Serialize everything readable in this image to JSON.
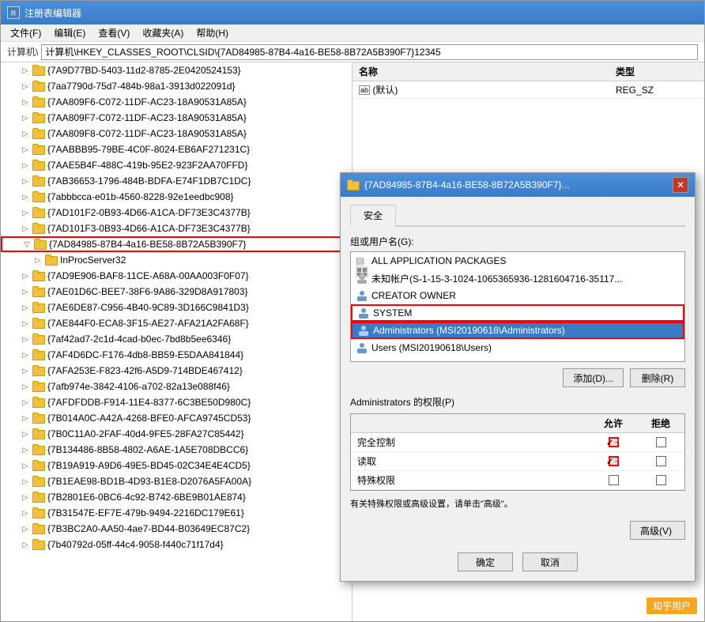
{
  "window": {
    "title": "注册表编辑器",
    "address": "计算机\\HKEY_CLASSES_ROOT\\CLSID\\{7AD84985-87B4-4a16-BE58-8B72A5B390F7}12345"
  },
  "menu": {
    "items": [
      "文件(F)",
      "编辑(E)",
      "查看(V)",
      "收藏夹(A)",
      "帮助(H)"
    ]
  },
  "tree": {
    "items": [
      {
        "label": "{7A9D77BD-5403-11d2-8785-2E0420524153}",
        "indent": 1,
        "expanded": false
      },
      {
        "label": "{7aa7790d-75d7-484b-98a1-3913d022091d}",
        "indent": 1,
        "expanded": false
      },
      {
        "label": "{7AA809F6-C072-11DF-AC23-18A90531A85A}",
        "indent": 1,
        "expanded": false
      },
      {
        "label": "{7AA809F7-C072-11DF-AC23-18A90531A85A}",
        "indent": 1,
        "expanded": false
      },
      {
        "label": "{7AA809F8-C072-11DF-AC23-18A90531A85A}",
        "indent": 1,
        "expanded": false
      },
      {
        "label": "{7AABBB95-79BE-4C0F-8024-EB6AF271231C}",
        "indent": 1,
        "expanded": false
      },
      {
        "label": "{7AAE5B4F-488C-419b-95E2-923F2AA70FFD}",
        "indent": 1,
        "expanded": false
      },
      {
        "label": "{7AB36653-1796-484B-BDFA-E74F1DB7C1DC}",
        "indent": 1,
        "expanded": false
      },
      {
        "label": "{7abbbcca-e01b-4560-8228-92e1eedbc908}",
        "indent": 1,
        "expanded": false
      },
      {
        "label": "{7AD101F2-0B93-4D66-A1CA-DF73E3C4377B}",
        "indent": 1,
        "expanded": false
      },
      {
        "label": "{7AD101F3-0B93-4D66-A1CA-DF73E3C4377B}",
        "indent": 1,
        "expanded": false
      },
      {
        "label": "{7AD84985-87B4-4a16-BE58-8B72A5B390F7}",
        "indent": 1,
        "expanded": true,
        "selected": false,
        "highlighted": true
      },
      {
        "label": "InProcServer32",
        "indent": 2,
        "expanded": false
      },
      {
        "label": "{7AD9E906-BAF8-11CE-A68A-00AA003F0F07}",
        "indent": 1,
        "expanded": false
      },
      {
        "label": "{7AE01D6C-BEE7-38F6-9A86-329D8A917803}",
        "indent": 1,
        "expanded": false
      },
      {
        "label": "{7AE6DE87-C956-4B40-9C89-3D166C9841D3}",
        "indent": 1,
        "expanded": false
      },
      {
        "label": "{7AE844F0-ECA8-3F15-AE27-AFA21A2FA68F}",
        "indent": 1,
        "expanded": false
      },
      {
        "label": "{7af42ad7-2c1d-4cad-b0ec-7bd8b5ee6346}",
        "indent": 1,
        "expanded": false
      },
      {
        "label": "{7AF4D6DC-F176-4db8-BB59-E5DAA841844}",
        "indent": 1,
        "expanded": false
      },
      {
        "label": "{7AFA253E-F823-42f6-A5D9-714BDE467412}",
        "indent": 1,
        "expanded": false
      },
      {
        "label": "{7afb974e-3842-4106-a702-82a13e088f46}",
        "indent": 1,
        "expanded": false
      },
      {
        "label": "{7AFDFDDB-F914-11E4-8377-6C3BE50D980C}",
        "indent": 1,
        "expanded": false
      },
      {
        "label": "{7B014A0C-A42A-4268-BFE0-AFCA9745CD53}",
        "indent": 1,
        "expanded": false
      },
      {
        "label": "{7B0C11A0-2FAF-40d4-9FE5-28FA27C85442}",
        "indent": 1,
        "expanded": false
      },
      {
        "label": "{7B134486-8B58-4802-A6AE-1A5E708DBCC6}",
        "indent": 1,
        "expanded": false
      },
      {
        "label": "{7B19A919-A9D6-49E5-BD45-02C34E4E4CD5}",
        "indent": 1,
        "expanded": false
      },
      {
        "label": "{7B1EAE98-BD1B-4D93-B1E8-D2076A5FA00A}",
        "indent": 1,
        "expanded": false
      },
      {
        "label": "{7B2801E6-0BC6-4c92-B742-6BE9B01AE874}",
        "indent": 1,
        "expanded": false
      },
      {
        "label": "{7B31547E-EF7E-479b-9494-2216DC179E61}",
        "indent": 1,
        "expanded": false
      },
      {
        "label": "{7B3BC2A0-AA50-4ae7-BD44-B03649EC87C2}",
        "indent": 1,
        "expanded": false
      },
      {
        "label": "{7b40792d-05ff-44c4-9058-f440c71f17d4}",
        "indent": 1,
        "expanded": false
      }
    ]
  },
  "right_panel": {
    "columns": [
      "名称",
      "类型"
    ],
    "rows": [
      {
        "name": "(默认)",
        "type": "REG_SZ",
        "icon": "ab"
      }
    ]
  },
  "security_dialog": {
    "title": "{7AD84985-87B4-4a16-BE58-8B72A5B390F7}...",
    "tab": "安全",
    "group_label": "组或用户名(G):",
    "groups": [
      {
        "name": "ALL APPLICATION PACKAGES",
        "icon": "packages"
      },
      {
        "name": "未知帐户(S-1-15-3-1024-1065365936-1281604716-35117...",
        "icon": "unknown"
      },
      {
        "name": "CREATOR OWNER",
        "icon": "person"
      },
      {
        "name": "SYSTEM",
        "icon": "person"
      },
      {
        "name": "Administrators (MSI20190618\\Administrators)",
        "icon": "shield",
        "selected": true
      },
      {
        "name": "Users (MSI20190618\\Users)",
        "icon": "person"
      }
    ],
    "add_btn": "添加(D)...",
    "remove_btn": "删除(R)",
    "perms_label": "Administrators 的权限(P)",
    "perms_columns": [
      "",
      "允许",
      "拒绝"
    ],
    "perms_rows": [
      {
        "name": "完全控制",
        "allow": "grayed-checked",
        "deny": "unchecked"
      },
      {
        "name": "读取",
        "allow": "grayed-checked",
        "deny": "unchecked"
      },
      {
        "name": "特殊权限",
        "allow": "unchecked",
        "deny": "unchecked"
      }
    ],
    "special_note": "有关特殊权限或高级设置，请单击\"高级\"。",
    "advanced_btn": "高级(V)",
    "ok_btn": "确定",
    "cancel_btn": "取消"
  },
  "watermark": "知乎用户"
}
